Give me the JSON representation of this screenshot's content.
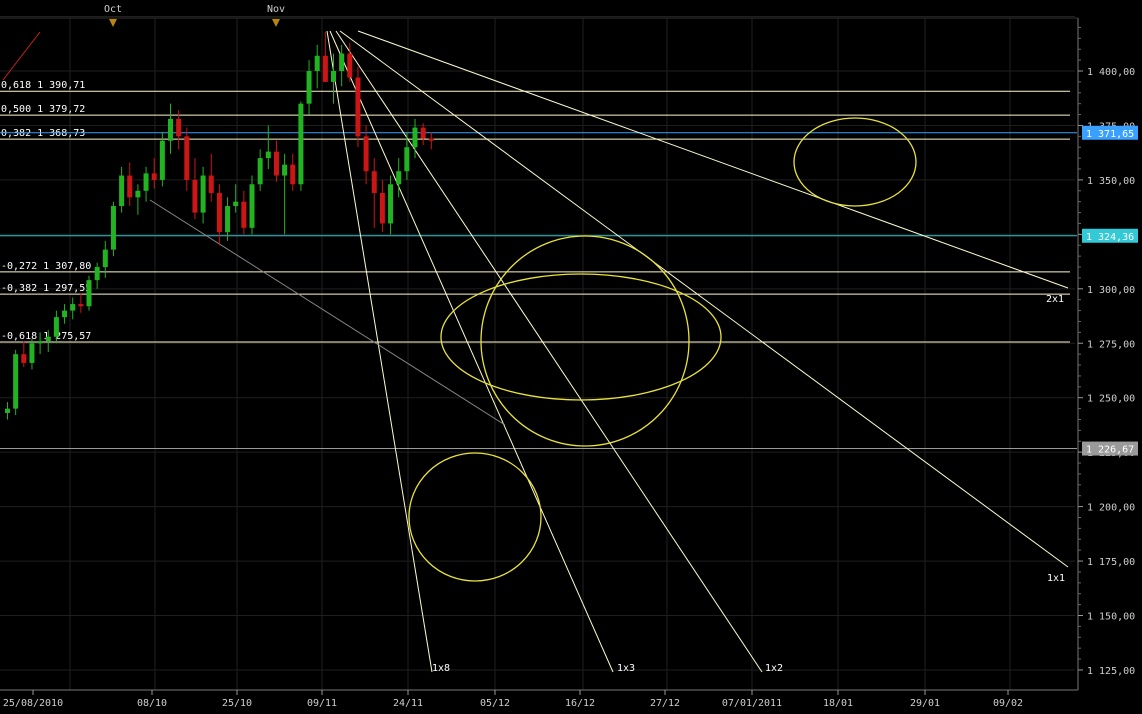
{
  "chart_data": {
    "type": "candlestick",
    "x_labels": [
      "25/08/2010",
      "08/10",
      "25/10",
      "09/11",
      "24/11",
      "05/12",
      "16/12",
      "27/12",
      "07/01/2011",
      "18/01",
      "29/01",
      "09/02"
    ],
    "month_markers": [
      "Oct",
      "Nov"
    ],
    "y_ticks": [
      "1 400,00",
      "1 375,00",
      "1 350,00",
      "1 325,00",
      "1 300,00",
      "1 275,00",
      "1 250,00",
      "1 225,00",
      "1 200,00",
      "1 175,00",
      "1 150,00",
      "1 125,00"
    ],
    "ylim": [
      1120,
      1430
    ],
    "price_tags": [
      {
        "label": "1 371,65",
        "value": 1371.65,
        "color": "#3aa0ff"
      },
      {
        "label": "1 324,36",
        "value": 1324.36,
        "color": "#33c9d6"
      },
      {
        "label": "1 226,67",
        "value": 1226.67,
        "color": "#9a9a9a"
      }
    ],
    "fib_levels": [
      {
        "label": "0,618  1 390,71",
        "value": 1390.71
      },
      {
        "label": "0,500  1 379,72",
        "value": 1379.72
      },
      {
        "label": "0,382  1 368,73",
        "value": 1368.73
      },
      {
        "label": "-0,272  1 307,80",
        "value": 1307.8
      },
      {
        "label": "-0,382  1 297,55",
        "value": 1297.55
      },
      {
        "label": "-0,618  1 275,57",
        "value": 1275.57
      }
    ],
    "gann_fan": {
      "labels": [
        "2x1",
        "1x1",
        "1x2",
        "1x3",
        "1x8"
      ]
    },
    "candles": [
      [
        1243,
        1248,
        1240,
        1245
      ],
      [
        1245,
        1272,
        1242,
        1270
      ],
      [
        1270,
        1276,
        1264,
        1266
      ],
      [
        1266,
        1277,
        1263,
        1275
      ],
      [
        1275,
        1280,
        1270,
        1276
      ],
      [
        1276,
        1281,
        1271,
        1278
      ],
      [
        1278,
        1290,
        1275,
        1287
      ],
      [
        1287,
        1293,
        1284,
        1290
      ],
      [
        1290,
        1296,
        1286,
        1293
      ],
      [
        1293,
        1298,
        1289,
        1292
      ],
      [
        1292,
        1306,
        1290,
        1304
      ],
      [
        1304,
        1312,
        1300,
        1310
      ],
      [
        1310,
        1322,
        1305,
        1318
      ],
      [
        1318,
        1340,
        1315,
        1338
      ],
      [
        1338,
        1356,
        1335,
        1352
      ],
      [
        1352,
        1358,
        1338,
        1342
      ],
      [
        1342,
        1348,
        1334,
        1345
      ],
      [
        1345,
        1356,
        1340,
        1353
      ],
      [
        1353,
        1360,
        1346,
        1350
      ],
      [
        1350,
        1372,
        1347,
        1368
      ],
      [
        1368,
        1385,
        1362,
        1378
      ],
      [
        1378,
        1382,
        1364,
        1370
      ],
      [
        1370,
        1374,
        1345,
        1350
      ],
      [
        1350,
        1360,
        1332,
        1335
      ],
      [
        1335,
        1356,
        1330,
        1352
      ],
      [
        1352,
        1362,
        1340,
        1344
      ],
      [
        1344,
        1348,
        1320,
        1326
      ],
      [
        1326,
        1342,
        1322,
        1338
      ],
      [
        1338,
        1348,
        1335,
        1340
      ],
      [
        1340,
        1345,
        1325,
        1328
      ],
      [
        1328,
        1352,
        1325,
        1348
      ],
      [
        1348,
        1364,
        1345,
        1360
      ],
      [
        1360,
        1375,
        1355,
        1363
      ],
      [
        1363,
        1368,
        1349,
        1352
      ],
      [
        1352,
        1362,
        1325,
        1357
      ],
      [
        1357,
        1362,
        1345,
        1348
      ],
      [
        1348,
        1386,
        1345,
        1385
      ],
      [
        1385,
        1405,
        1380,
        1400
      ],
      [
        1400,
        1412,
        1392,
        1407
      ],
      [
        1407,
        1418,
        1398,
        1395
      ],
      [
        1395,
        1408,
        1385,
        1400
      ],
      [
        1400,
        1412,
        1393,
        1408
      ],
      [
        1408,
        1413,
        1395,
        1397
      ],
      [
        1397,
        1402,
        1365,
        1370
      ],
      [
        1370,
        1375,
        1348,
        1354
      ],
      [
        1354,
        1360,
        1328,
        1344
      ],
      [
        1344,
        1350,
        1326,
        1330
      ],
      [
        1330,
        1352,
        1325,
        1348
      ],
      [
        1348,
        1360,
        1342,
        1354
      ],
      [
        1354,
        1372,
        1350,
        1365
      ],
      [
        1365,
        1378,
        1360,
        1374
      ],
      [
        1374,
        1376,
        1366,
        1369
      ],
      [
        1369,
        1372,
        1364,
        1368
      ]
    ]
  }
}
